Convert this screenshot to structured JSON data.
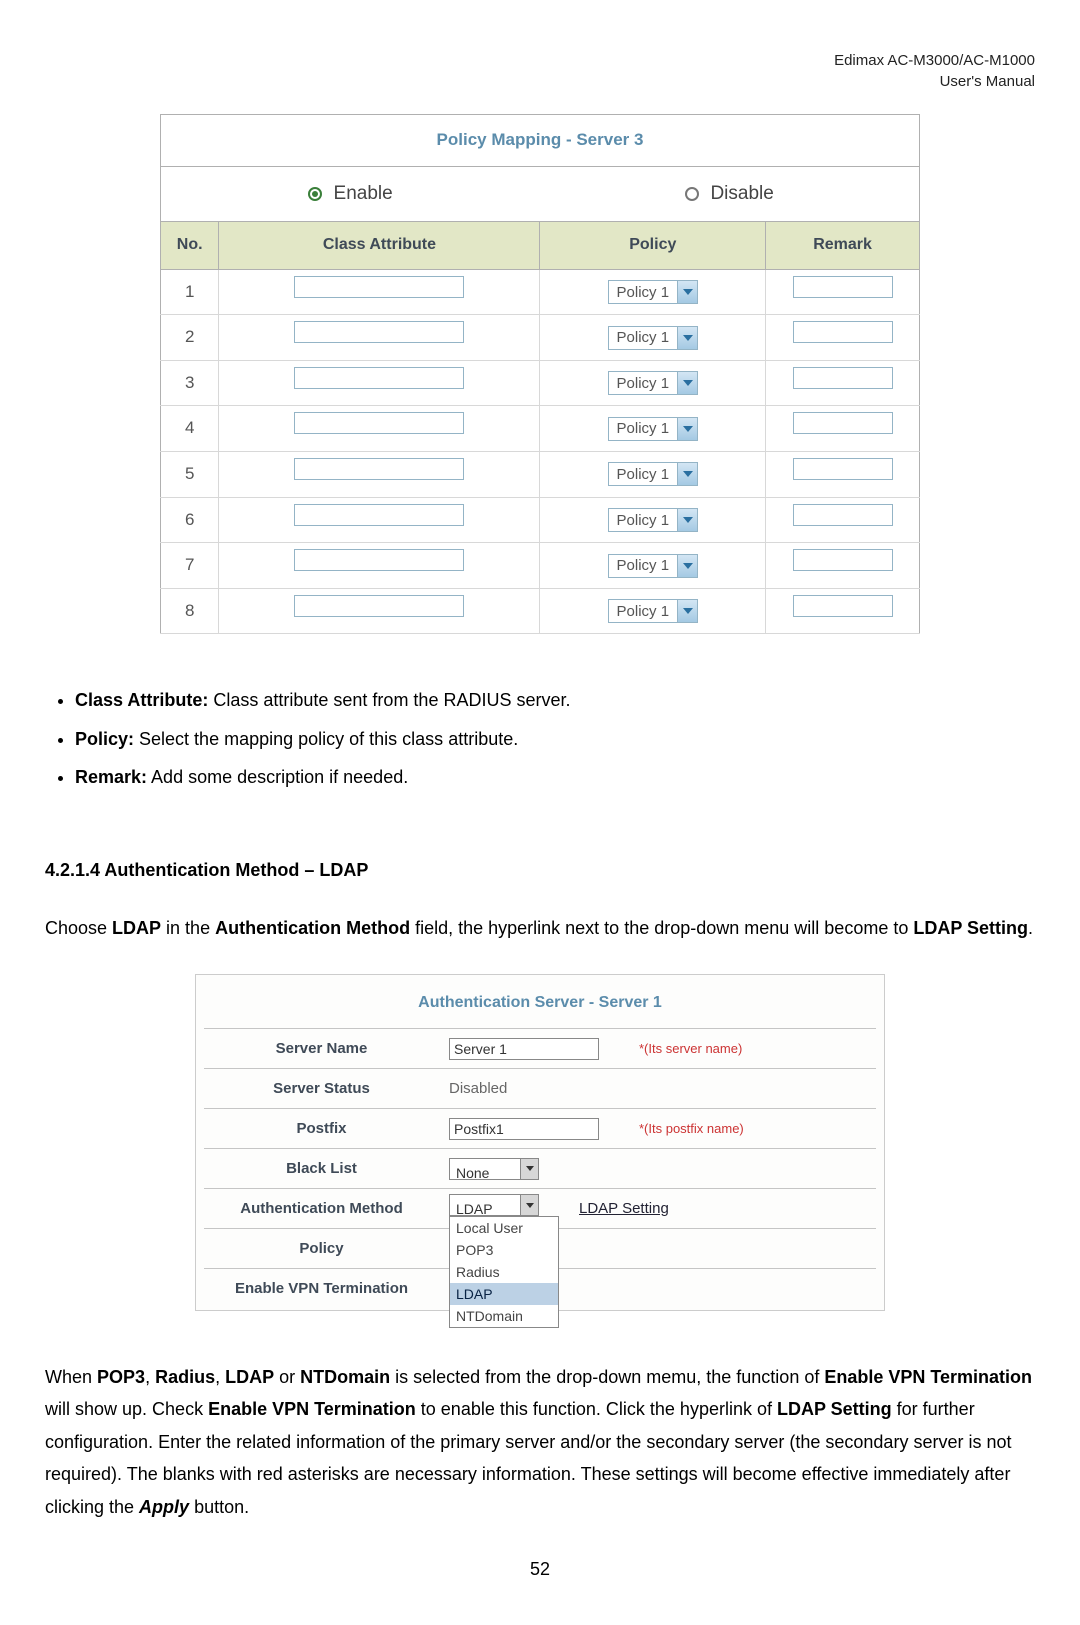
{
  "header": {
    "line1": "Edimax  AC-M3000/AC-M1000",
    "line2": "User's  Manual"
  },
  "policy_mapping": {
    "title": "Policy Mapping - Server 3",
    "enable_label": "Enable",
    "disable_label": "Disable",
    "col_no": "No.",
    "col_class": "Class Attribute",
    "col_policy": "Policy",
    "col_remark": "Remark",
    "rows": [
      {
        "no": "1",
        "policy": "Policy 1"
      },
      {
        "no": "2",
        "policy": "Policy 1"
      },
      {
        "no": "3",
        "policy": "Policy 1"
      },
      {
        "no": "4",
        "policy": "Policy 1"
      },
      {
        "no": "5",
        "policy": "Policy 1"
      },
      {
        "no": "6",
        "policy": "Policy 1"
      },
      {
        "no": "7",
        "policy": "Policy 1"
      },
      {
        "no": "8",
        "policy": "Policy 1"
      }
    ]
  },
  "notes": {
    "item1_b": "Class Attribute:",
    "item1_t": " Class attribute sent from the RADIUS server.",
    "item2_b": "Policy:",
    "item2_t": " Select the mapping policy of this class attribute.",
    "item3_b": "Remark:",
    "item3_t": " Add some description if needed."
  },
  "section_heading": "4.2.1.4  Authentication Method – LDAP",
  "para1_a": "Choose ",
  "para1_b1": "LDAP",
  "para1_b": " in the ",
  "para1_b2": "Authentication Method",
  "para1_c": " field, the hyperlink next to the drop-down menu will become to ",
  "para1_b3": "LDAP Setting",
  "para1_d": ".",
  "auth_server": {
    "title": "Authentication Server - Server 1",
    "rows": {
      "server_name": {
        "label": "Server Name",
        "value": "Server 1",
        "note": "*(Its server name)"
      },
      "server_status": {
        "label": "Server Status",
        "value": "Disabled"
      },
      "postfix": {
        "label": "Postfix",
        "value": "Postfix1",
        "note": "*(Its postfix name)"
      },
      "black_list": {
        "label": "Black List",
        "value": "None"
      },
      "auth_method": {
        "label": "Authentication Method",
        "value": "LDAP",
        "link": "LDAP Setting"
      },
      "policy": {
        "label": "Policy"
      },
      "enable_vpn": {
        "label": "Enable VPN Termination"
      }
    },
    "dd_options": {
      "o1": "Local User",
      "o2": "POP3",
      "o3": "Radius",
      "o4": "LDAP",
      "o5": "NTDomain"
    }
  },
  "para2_a": "When ",
  "para2_b1": "POP3",
  "para2_s1": ", ",
  "para2_b2": "Radius",
  "para2_s2": ", ",
  "para2_b3": "LDAP",
  "para2_s3": " or ",
  "para2_b4": "NTDomain",
  "para2_c": " is selected from the drop-down memu, the function of ",
  "para2_b5": "Enable VPN Termination",
  "para2_d": " will show up. Check ",
  "para2_b6": "Enable VPN Termination",
  "para2_e": " to enable this function. Click the hyperlink of ",
  "para2_b7": "LDAP Setting",
  "para2_f": " for further configuration. Enter the related information of the primary server and/or the secondary server (the secondary server is not required). The blanks with red asterisks are necessary information. These settings will become effective immediately after clicking the ",
  "para2_bi": "Apply",
  "para2_g": " button.",
  "page_number": "52"
}
